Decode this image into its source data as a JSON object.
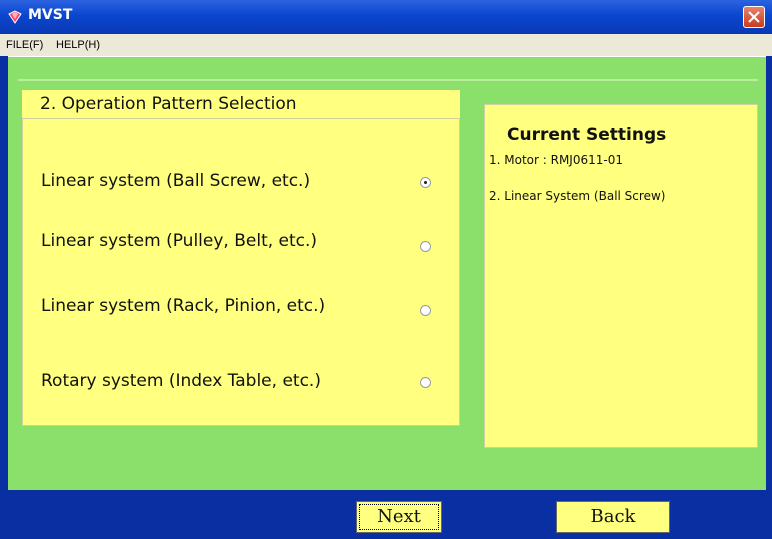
{
  "window": {
    "title": "MVST"
  },
  "menu": {
    "items": [
      "FILE(F)",
      "HELP(H)"
    ]
  },
  "section": {
    "heading": "2. Operation Pattern Selection"
  },
  "options": [
    {
      "label": "Linear system (Ball Screw, etc.)",
      "selected": true
    },
    {
      "label": "Linear system (Pulley, Belt, etc.)",
      "selected": false
    },
    {
      "label": "Linear system (Rack, Pinion, etc.)",
      "selected": false
    },
    {
      "label": "Rotary system (Index Table, etc.)",
      "selected": false
    }
  ],
  "settings": {
    "title": "Current Settings",
    "lines": [
      "1. Motor : RMJ0611-01",
      "2. Linear System (Ball Screw)"
    ]
  },
  "buttons": {
    "next": "Next",
    "back": "Back"
  },
  "colors": {
    "panel": "#ffff80",
    "background": "#8ae06a",
    "frame": "#0a2fa3",
    "close": "#c83a1e"
  }
}
